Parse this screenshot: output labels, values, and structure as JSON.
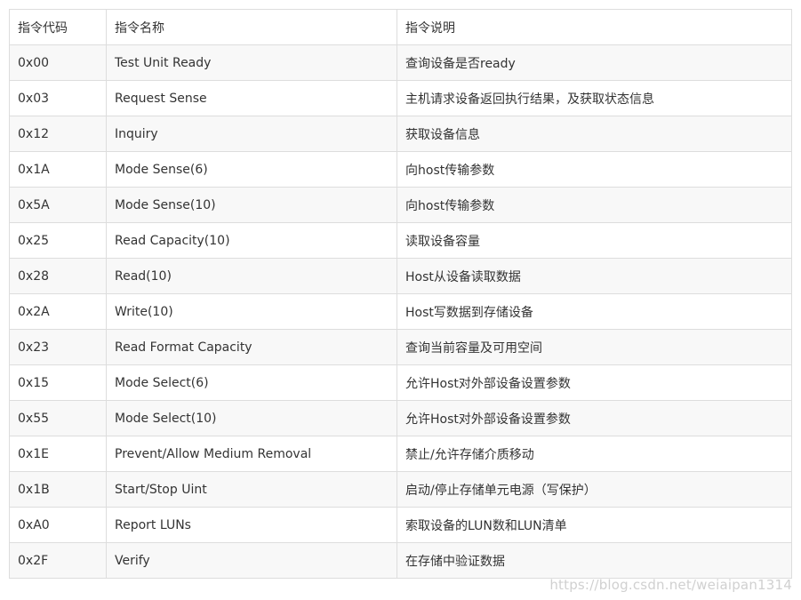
{
  "table": {
    "headers": [
      "指令代码",
      "指令名称",
      "指令说明"
    ],
    "rows": [
      [
        "0x00",
        "Test Unit Ready",
        "查询设备是否ready"
      ],
      [
        "0x03",
        "Request Sense",
        "主机请求设备返回执行结果，及获取状态信息"
      ],
      [
        "0x12",
        "Inquiry",
        "获取设备信息"
      ],
      [
        "0x1A",
        "Mode Sense(6)",
        "向host传输参数"
      ],
      [
        "0x5A",
        "Mode Sense(10)",
        "向host传输参数"
      ],
      [
        "0x25",
        "Read Capacity(10)",
        "读取设备容量"
      ],
      [
        "0x28",
        "Read(10)",
        "Host从设备读取数据"
      ],
      [
        "0x2A",
        "Write(10)",
        "Host写数据到存储设备"
      ],
      [
        "0x23",
        "Read Format Capacity",
        "查询当前容量及可用空间"
      ],
      [
        "0x15",
        "Mode Select(6)",
        "允许Host对外部设备设置参数"
      ],
      [
        "0x55",
        "Mode Select(10)",
        "允许Host对外部设备设置参数"
      ],
      [
        "0x1E",
        "Prevent/Allow Medium Removal",
        "禁止/允许存储介质移动"
      ],
      [
        "0x1B",
        "Start/Stop Uint",
        "启动/停止存储单元电源（写保护）"
      ],
      [
        "0xA0",
        "Report LUNs",
        "索取设备的LUN数和LUN清单"
      ],
      [
        "0x2F",
        "Verify",
        "在存储中验证数据"
      ]
    ]
  },
  "watermark": "https://blog.csdn.net/weiaipan1314"
}
